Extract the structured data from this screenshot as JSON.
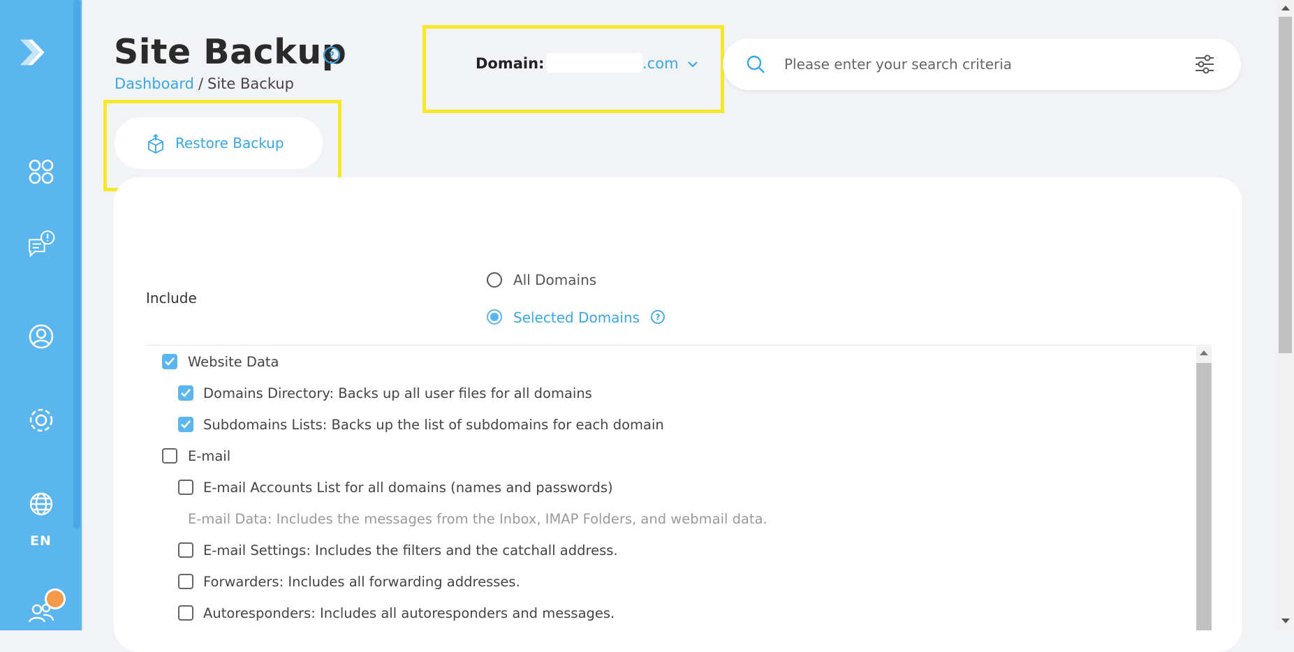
{
  "header": {
    "title": "Site Backup",
    "breadcrumb": {
      "link": "Dashboard",
      "separator": "/",
      "current": "Site Backup"
    },
    "domain": {
      "label": "Domain:",
      "value": ".com"
    },
    "search": {
      "placeholder": "Please enter your search criteria"
    }
  },
  "actions": {
    "restore_label": "Restore Backup"
  },
  "sidebar": {
    "items": [
      {
        "name": "logo",
        "icon": "chevron-logo-icon"
      },
      {
        "name": "dashboard",
        "icon": "grid-icon"
      },
      {
        "name": "support",
        "icon": "chat-alert-icon"
      },
      {
        "name": "account",
        "icon": "user-circle-icon"
      },
      {
        "name": "settings",
        "icon": "gear-icon"
      },
      {
        "name": "language",
        "icon": "globe-icon",
        "label": "EN"
      },
      {
        "name": "users",
        "icon": "users-icon"
      }
    ]
  },
  "form": {
    "include_label": "Include",
    "scope_options": [
      {
        "label": "All Domains",
        "selected": false
      },
      {
        "label": "Selected Domains",
        "selected": true
      }
    ],
    "items": [
      {
        "label": "Website Data",
        "checked": true,
        "level": 0
      },
      {
        "label": "Domains Directory: Backs up all user files for all domains",
        "checked": true,
        "level": 1
      },
      {
        "label": "Subdomains Lists: Backs up the list of subdomains for each domain",
        "checked": true,
        "level": 1
      },
      {
        "label": "E-mail",
        "checked": false,
        "level": 0
      },
      {
        "label": "E-mail Accounts List for all domains (names and passwords)",
        "checked": false,
        "level": 1
      },
      {
        "label": "E-mail Data: Includes the messages from the Inbox, IMAP Folders, and webmail data.",
        "checked": false,
        "level": 1,
        "disabled": true
      },
      {
        "label": "E-mail Settings: Includes the filters and the catchall address.",
        "checked": false,
        "level": 1
      },
      {
        "label": "Forwarders: Includes all forwarding addresses.",
        "checked": false,
        "level": 1
      },
      {
        "label": "Autoresponders: Includes all autoresponders and messages.",
        "checked": false,
        "level": 1
      }
    ]
  },
  "colors": {
    "sidebar": "#5bb5ee",
    "accent": "#3aa6e5",
    "highlight": "#f6e829",
    "notification": "#f39a4a"
  }
}
